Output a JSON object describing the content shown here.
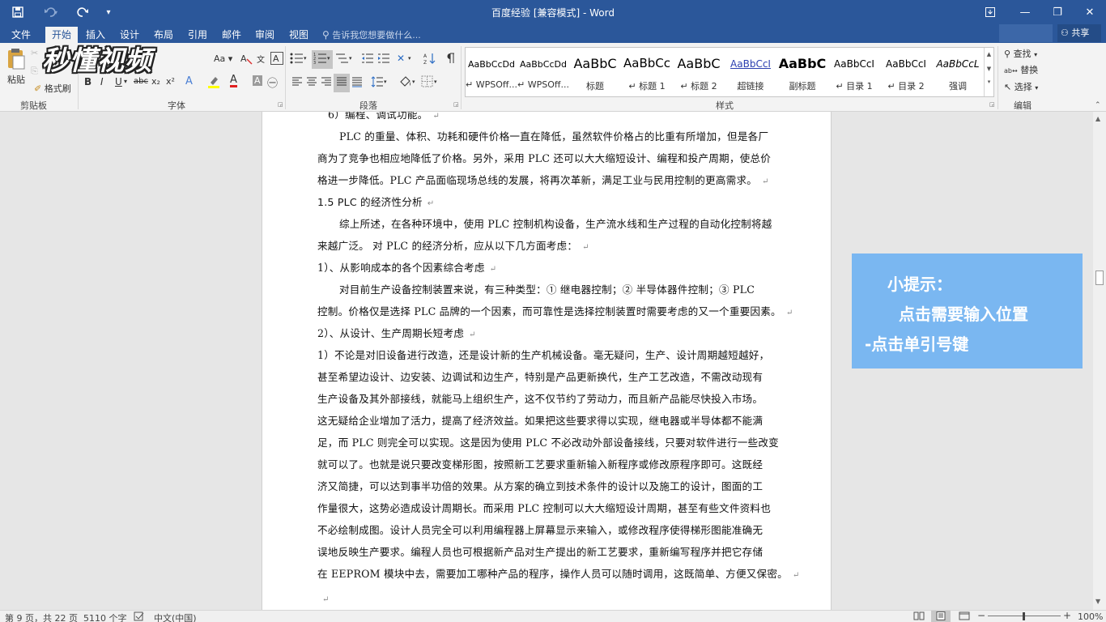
{
  "window": {
    "title": "百度经验 [兼容模式] - Word"
  },
  "quick_access": {
    "save_icon": "save-icon",
    "undo_icon": "undo-icon",
    "redo_icon": "redo-icon",
    "customize_icon": "customize-qat-icon"
  },
  "window_controls": {
    "ribbon_display_icon": "ribbon-display-icon",
    "minimize_label": "—",
    "restore_label": "❐",
    "close_label": "✕"
  },
  "tabs": [
    "文件",
    "开始",
    "插入",
    "设计",
    "布局",
    "引用",
    "邮件",
    "审阅",
    "视图"
  ],
  "active_tab": "开始",
  "tell_me": "告诉我您想要做什么...",
  "share_label": "共享",
  "watermark_logo": "秒懂视频",
  "ribbon": {
    "clipboard": {
      "label": "剪贴板",
      "paste": "粘贴",
      "format_painter": "格式刷"
    },
    "font": {
      "label": "字体",
      "aa_label": "Aa",
      "bold": "B",
      "italic": "I",
      "underline": "U",
      "strike": "abc",
      "subscript": "x₂",
      "superscript": "x²",
      "highlight": "A",
      "font_color": "A",
      "shading": "A",
      "enclose": "㊀"
    },
    "paragraph": {
      "label": "段落"
    },
    "styles": {
      "label": "样式",
      "items": [
        {
          "sample": "AaBbCcDd",
          "name": "WPSOff..."
        },
        {
          "sample": "AaBbCcDd",
          "name": "WPSOff..."
        },
        {
          "sample": "AaBbC",
          "name": "标题"
        },
        {
          "sample": "AaBbCc",
          "name": "标题 1"
        },
        {
          "sample": "AaBbC",
          "name": "标题 2"
        },
        {
          "sample": "AaBbCcI",
          "name": "超链接"
        },
        {
          "sample": "AaBbC",
          "name": "副标题"
        },
        {
          "sample": "AaBbCcI",
          "name": "目录 1"
        },
        {
          "sample": "AaBbCcI",
          "name": "目录 2"
        },
        {
          "sample": "AaBbCcL",
          "name": "强调"
        }
      ]
    },
    "editing": {
      "label": "编辑",
      "find": "查找",
      "replace": "替换",
      "select": "选择"
    }
  },
  "document": {
    "lines": [
      {
        "text": "6）编程、调试功能。",
        "pm": "↵"
      },
      {
        "text": "PLC 的重量、体积、功耗和硬件价格一直在降低，虽然软件价格占的比重有所增加，但是各厂",
        "indent": true
      },
      {
        "text": "商为了竞争也相应地降低了价格。另外，采用 PLC 还可以大大缩短设计、编程和投产周期，使总价"
      },
      {
        "text": "格进一步降低。PLC 产品面临现场总线的发展，将再次革新，满足工业与民用控制的更高需求。",
        "pm": "↵"
      },
      {
        "text": "1.5  PLC 的经济性分析",
        "pm": "↵",
        "heading": true
      },
      {
        "text": "综上所述，在各种环境中，使用 PLC 控制机构设备，生产流水线和生产过程的自动化控制将越",
        "indent": true
      },
      {
        "text": "来越广泛。   对 PLC 的经济分析，应从以下几方面考虑：",
        "pm": "↵"
      },
      {
        "text": "1）、从影响成本的各个因素综合考虑",
        "pm": "↵"
      },
      {
        "text": "对目前生产设备控制装置来说，有三种类型：① 继电器控制；② 半导体器件控制；③ PLC",
        "indent": true
      },
      {
        "text": "控制。价格仅是选择 PLC 品牌的一个因素，而可靠性是选择控制装置时需要考虑的又一个重要因素。",
        "pm": "↵"
      },
      {
        "text": "2）、从设计、生产周期长短考虑",
        "pm": "↵"
      },
      {
        "text": "1）不论是对旧设备进行改造，还是设计新的生产机械设备。毫无疑问，生产、设计周期越短越好，"
      },
      {
        "text": "甚至希望边设计、边安装、边调试和边生产，特别是产品更新换代，生产工艺改造，不需改动现有"
      },
      {
        "text": "生产设备及其外部接线，就能马上组织生产，这不仅节约了劳动力，而且新产品能尽快投入市场。"
      },
      {
        "text": "这无疑给企业增加了活力，提高了经济效益。如果把这些要求得以实现，继电器或半导体都不能满"
      },
      {
        "text": "足，而 PLC 则完全可以实现。这是因为使用 PLC 不必改动外部设备接线，只要对软件进行一些改变"
      },
      {
        "text": "就可以了。也就是说只要改变梯形图，按照新工艺要求重新输入新程序或修改原程序即可。这既经"
      },
      {
        "text": "济又简捷，可以达到事半功倍的效果。从方案的确立到技术条件的设计以及施工的设计，图面的工"
      },
      {
        "text": "作量很大，这势必造成设计周期长。而采用 PLC 控制可以大大缩短设计周期，甚至有些文件资料也"
      },
      {
        "text": "不必绘制成图。设计人员完全可以利用编程器上屏幕显示来输入，或修改程序使得梯形图能准确无"
      },
      {
        "text": "误地反映生产要求。编程人员也可根据新产品对生产提出的新工艺要求，重新编写程序并把它存储"
      },
      {
        "text": "在 EEPROM 模块中去，需要加工哪种产品的程序，操作人员可以随时调用，这既简单、方便又保密。",
        "pm": "↵"
      },
      {
        "text": "",
        "pm": "↵"
      }
    ]
  },
  "tip": {
    "line1": "小提示：",
    "line2": "点击需要输入位置",
    "line3": "-点击单引号键"
  },
  "status": {
    "page": "第 9 页，共 22 页",
    "words": "5110 个字",
    "proof_icon": "proofing-icon",
    "language": "中文(中国)",
    "zoom_minus": "−",
    "zoom_plus": "+",
    "zoom": "100%"
  }
}
